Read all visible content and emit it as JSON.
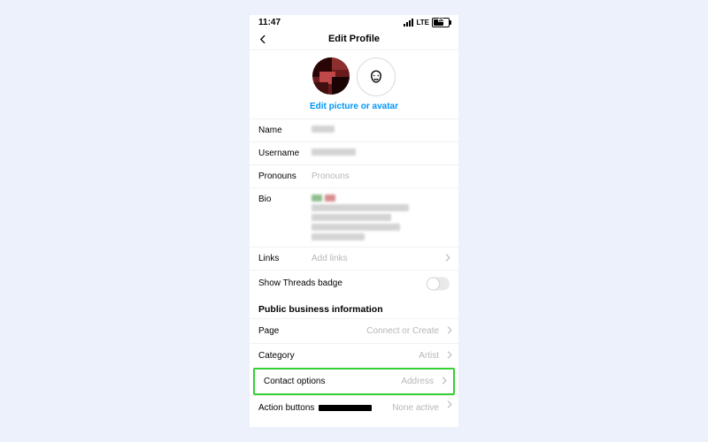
{
  "statusbar": {
    "time": "11:47",
    "net": "LTE",
    "battery": "62"
  },
  "header": {
    "title": "Edit Profile"
  },
  "avatarsection": {
    "edit_link": "Edit picture or avatar"
  },
  "fields": {
    "name": {
      "label": "Name"
    },
    "username": {
      "label": "Username"
    },
    "pronouns": {
      "label": "Pronouns",
      "placeholder": "Pronouns"
    },
    "bio": {
      "label": "Bio"
    },
    "links": {
      "label": "Links",
      "placeholder": "Add links"
    },
    "threads": {
      "label": "Show Threads badge"
    }
  },
  "business": {
    "heading": "Public business information",
    "page": {
      "label": "Page",
      "value": "Connect or Create"
    },
    "category": {
      "label": "Category",
      "value": "Artist"
    },
    "contact": {
      "label": "Contact options",
      "value": "Address"
    },
    "action": {
      "label": "Action buttons",
      "value": "None active"
    }
  }
}
